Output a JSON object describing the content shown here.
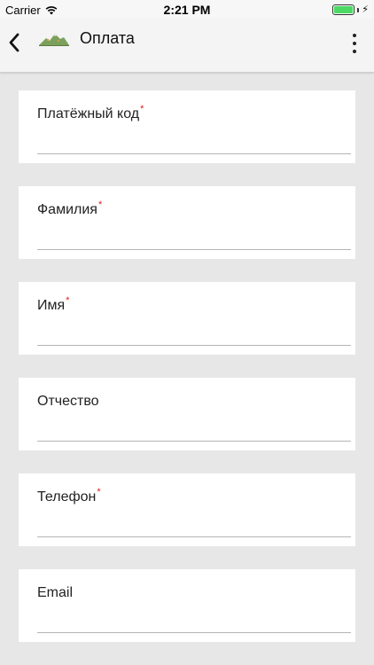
{
  "status_bar": {
    "carrier": "Carrier",
    "time": "2:21 PM",
    "wifi_icon": "wifi-icon",
    "battery_level": 1.0,
    "battery_color": "#4cd964"
  },
  "app_bar": {
    "title": "Оплата",
    "back_icon": "chevron-left-icon",
    "logo_icon": "mountain-logo-icon",
    "menu_icon": "more-vertical-icon"
  },
  "fields": [
    {
      "label": "Платёжный код",
      "required": true,
      "required_mark": "*",
      "value": ""
    },
    {
      "label": "Фамилия",
      "required": true,
      "required_mark": "*",
      "value": ""
    },
    {
      "label": "Имя",
      "required": true,
      "required_mark": "*",
      "value": ""
    },
    {
      "label": "Отчество",
      "required": false,
      "required_mark": "",
      "value": ""
    },
    {
      "label": "Телефон",
      "required": true,
      "required_mark": "*",
      "value": ""
    },
    {
      "label": "Email",
      "required": false,
      "required_mark": "",
      "value": ""
    }
  ],
  "colors": {
    "required": "#e02020",
    "background": "#e7e7e7",
    "card": "#ffffff"
  }
}
